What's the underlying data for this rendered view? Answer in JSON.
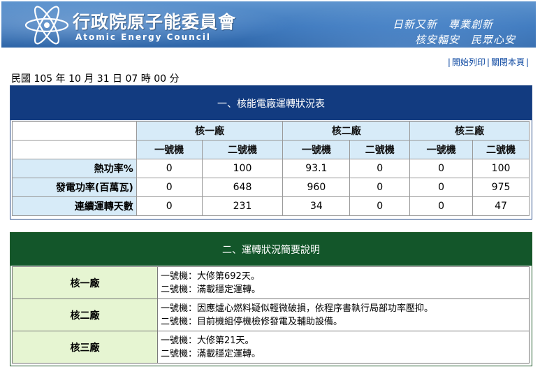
{
  "header": {
    "title_zh": "行政院原子能委員會",
    "title_en": "Atomic Energy Council",
    "slogan_line1": "日新又新　專業創新",
    "slogan_line2": "核安輻安　民眾心安"
  },
  "links": {
    "print": "開始列印",
    "close": "關閉本頁"
  },
  "timestamp": "民國 105 年 10 月 31 日 07 時 00 分",
  "status_table": {
    "title": "一、核能電廠運轉狀況表",
    "plants": [
      "核一廠",
      "核二廠",
      "核三廠"
    ],
    "units": [
      "一號機",
      "二號機",
      "一號機",
      "二號機",
      "一號機",
      "二號機"
    ],
    "rows": [
      {
        "label": "熱功率%",
        "values": [
          "0",
          "100",
          "93.1",
          "0",
          "0",
          "100"
        ]
      },
      {
        "label": "發電功率(百萬瓦)",
        "values": [
          "0",
          "648",
          "960",
          "0",
          "0",
          "975"
        ]
      },
      {
        "label": "連續運轉天數",
        "values": [
          "0",
          "231",
          "34",
          "0",
          "0",
          "47"
        ]
      }
    ]
  },
  "notes_table": {
    "title": "二、運轉狀況簡要說明",
    "rows": [
      {
        "plant": "核一廠",
        "line1": "一號機：大修第692天。",
        "line2": "二號機：滿載穩定運轉。"
      },
      {
        "plant": "核二廠",
        "line1": "一號機：因應爐心燃料疑似輕微破損，依程序書執行局部功率壓抑。",
        "line2": "二號機：目前機組停機檢修發電及輔助設備。"
      },
      {
        "plant": "核三廠",
        "line1": "一號機：大修第21天。",
        "line2": "二號機：滿載穩定運轉。"
      }
    ]
  },
  "colors": {
    "banner": "#3d78bd",
    "status_title_bg": "#123b80",
    "status_header_bg": "#d7ebf8",
    "notes_title_bg": "#13562a",
    "notes_plant_bg": "#e6f5d2"
  },
  "icons": {
    "logo": "atom-icon"
  }
}
